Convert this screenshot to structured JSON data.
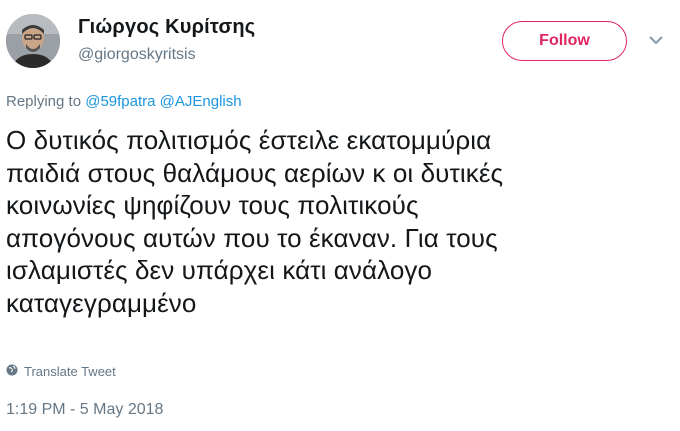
{
  "user": {
    "display_name": "Γιώργος Κυρίτσης",
    "handle": "@giorgoskyritsis"
  },
  "follow_button": {
    "label": "Follow",
    "color": "#e0245e"
  },
  "reply": {
    "prefix": "Replying to",
    "mentions": [
      "@59fpatra",
      "@AJEnglish"
    ],
    "mention_color": "#1b95e0"
  },
  "tweet": {
    "text": "Ο δυτικός πολιτισμός έστειλε εκατομμύρια\nπαιδιά στους θαλάμους αερίων κ οι δυτικές\nκοινωνίες ψηφίζουν τους πολιτικούς\nαπογόνους αυτών που το έκαναν. Για τους\nισλαμιστές δεν υπάρχει κάτι ανάλογο\nκαταγεγραμμένο"
  },
  "translate": {
    "label": "Translate Tweet",
    "icon": "globe-icon"
  },
  "timestamp": "1:19 PM - 5 May 2018",
  "icons": {
    "more": "chevron-down-icon"
  }
}
